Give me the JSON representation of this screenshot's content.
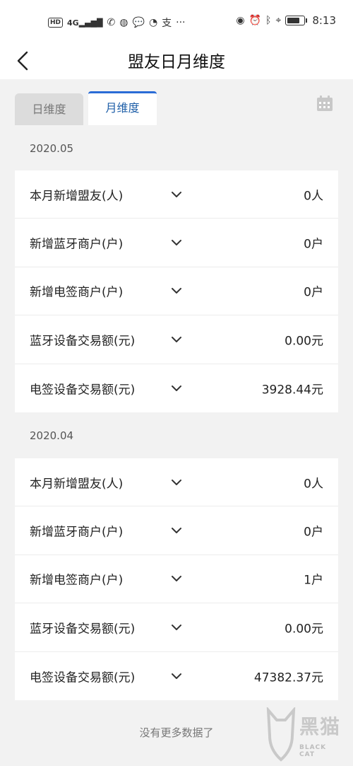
{
  "status_bar": {
    "left_chips": [
      "HD",
      "4G"
    ],
    "time": "8:13",
    "battery_level": 0.75
  },
  "header": {
    "title": "盟友日月维度"
  },
  "tabs": [
    {
      "label": "日维度",
      "active": false
    },
    {
      "label": "月维度",
      "active": true
    }
  ],
  "sections": [
    {
      "date": "2020.05",
      "rows": [
        {
          "label": "本月新增盟友(人)",
          "value": "0人"
        },
        {
          "label": "新增蓝牙商户(户)",
          "value": "0户"
        },
        {
          "label": "新增电签商户(户)",
          "value": "0户"
        },
        {
          "label": "蓝牙设备交易额(元)",
          "value": "0.00元"
        },
        {
          "label": "电签设备交易额(元)",
          "value": "3928.44元"
        }
      ]
    },
    {
      "date": "2020.04",
      "rows": [
        {
          "label": "本月新增盟友(人)",
          "value": "0人"
        },
        {
          "label": "新增蓝牙商户(户)",
          "value": "0户"
        },
        {
          "label": "新增电签商户(户)",
          "value": "1户"
        },
        {
          "label": "蓝牙设备交易额(元)",
          "value": "0.00元"
        },
        {
          "label": "电签设备交易额(元)",
          "value": "47382.37元"
        }
      ]
    }
  ],
  "footer": {
    "text": "没有更多数据了"
  },
  "watermark": {
    "brand": "黑猫",
    "sub": "BLACK CAT"
  },
  "colors": {
    "accent": "#2a6cd6",
    "background": "#f2f2f2"
  }
}
